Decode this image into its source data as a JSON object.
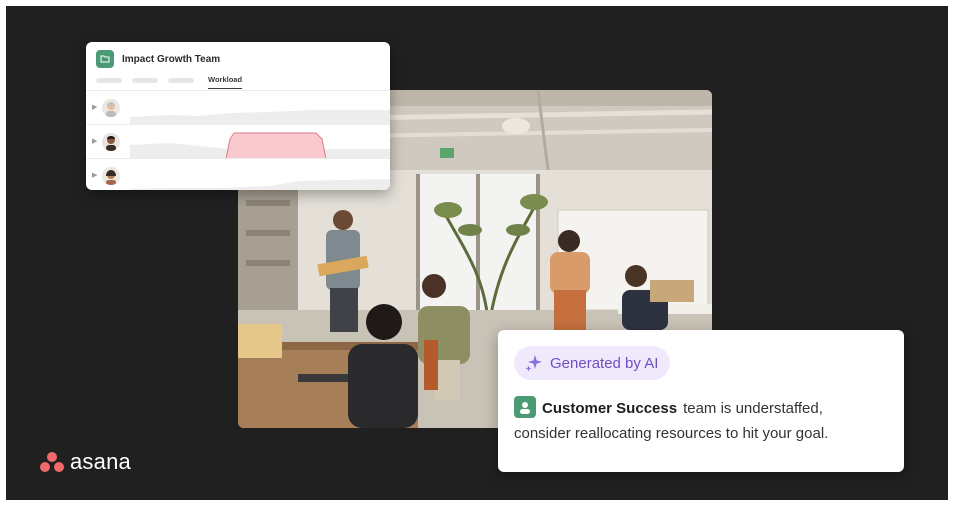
{
  "workload_card": {
    "title": "Impact Growth Team",
    "active_tab": "Workload",
    "title_icon": "folder-icon",
    "rows": [
      {
        "avatar": "avatar-person-1",
        "status": "normal"
      },
      {
        "avatar": "avatar-person-2",
        "status": "overloaded"
      },
      {
        "avatar": "avatar-person-3",
        "status": "normal"
      }
    ],
    "colors": {
      "overloaded_fill": "#f8c9cf",
      "overloaded_stroke": "#e07a88",
      "workload_fill": "#ececec",
      "folder": "#4a9a73"
    }
  },
  "ai_card": {
    "badge_label": "Generated by AI",
    "badge_icon": "sparkle-icon",
    "team_icon": "team-icon",
    "team_name": "Customer Success",
    "message_part1": "team is understaffed,",
    "message_part2": "consider reallocating resources to hit your goal.",
    "colors": {
      "badge_bg": "#efe9fb",
      "badge_text": "#6e4fc4",
      "team_icon": "#4a9a73"
    }
  },
  "brand": {
    "name": "asana",
    "logo_icon": "asana-logo-icon",
    "logo_color": "#f06a6a"
  },
  "photo": {
    "icon": "office-photo"
  }
}
